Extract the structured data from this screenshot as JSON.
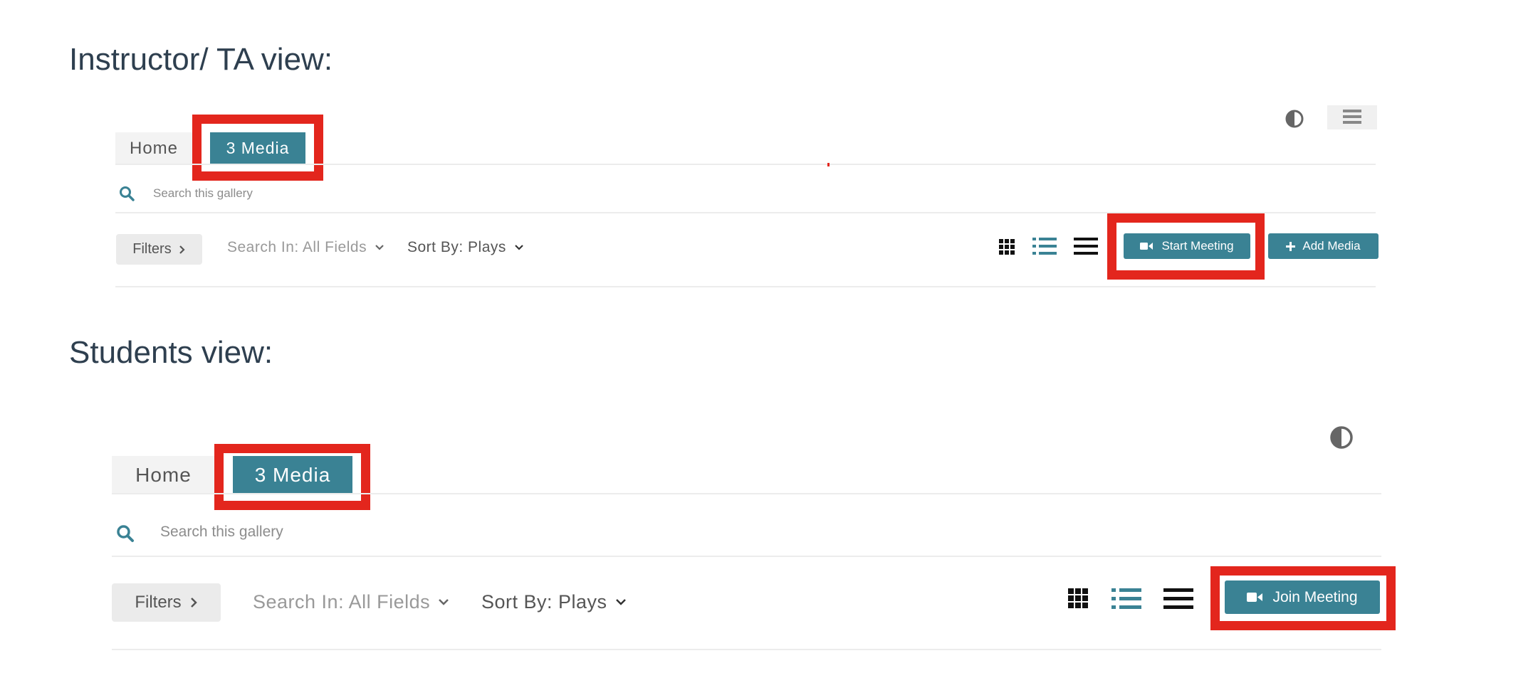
{
  "instructor": {
    "heading": "Instructor/ TA view:",
    "tabs": {
      "home": "Home",
      "media": "3 Media"
    },
    "search": {
      "placeholder": "Search this gallery"
    },
    "toolbar": {
      "filters": "Filters",
      "search_in": "Search In: All Fields",
      "sort_by": "Sort By: Plays",
      "start_meeting": "Start Meeting",
      "add_media": "Add Media"
    }
  },
  "student": {
    "heading": "Students view:",
    "tabs": {
      "home": "Home",
      "media": "3 Media"
    },
    "search": {
      "placeholder": "Search this gallery"
    },
    "toolbar": {
      "filters": "Filters",
      "search_in": "Search In: All Fields",
      "sort_by": "Sort By: Plays",
      "join_meeting": "Join Meeting"
    }
  },
  "icons": [
    "contrast-icon",
    "menu-toggle-icon",
    "search-icon",
    "chevron-right-icon",
    "chevron-down-icon",
    "grid-view-icon",
    "detailed-list-view-icon",
    "compact-list-view-icon",
    "video-camera-icon",
    "plus-icon"
  ],
  "colors": {
    "accent": "#3a8294",
    "highlight": "#e3261d",
    "heading": "#2e3f4f"
  }
}
